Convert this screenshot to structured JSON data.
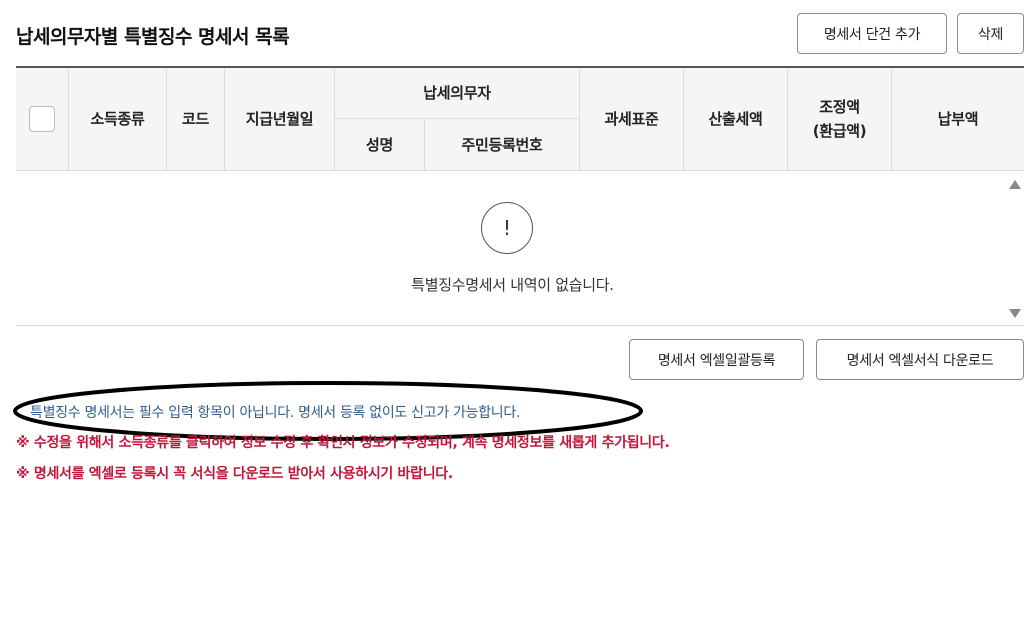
{
  "page": {
    "title": "납세의무자별 특별징수 명세서 목록",
    "add_button": "명세서 단건 추가",
    "delete_button": "삭제"
  },
  "table": {
    "headers": {
      "income_type": "소득종류",
      "code": "코드",
      "pay_date": "지급년월일",
      "taxpayer_group": "납세의무자",
      "name": "성명",
      "resident_number": "주민등록번호",
      "tax_base": "과세표준",
      "calculated_tax": "산출세액",
      "adjustment_line1": "조정액",
      "adjustment_line2": "(환급액)",
      "payment_amount": "납부액"
    },
    "empty_icon": "!",
    "empty_message": "특별징수명세서 내역이 없습니다."
  },
  "actions": {
    "excel_upload": "명세서 엑셀일괄등록",
    "excel_template_download": "명세서 엑셀서식 다운로드"
  },
  "notices": {
    "info": "특별징수 명세서는 필수 입력 항목이 아닙니다. 명세서 등록 없이도 신고가 가능합니다.",
    "warning_1": "※ 수정을 위해서 소득종류를 클릭하여 정보 수정 후 확인시 정보가 수정되며, 계속 명세정보를 새롭게 추가됩니다.",
    "warning_2": "※ 명세서를 엑셀로 등록시 꼭 서식을 다운로드 받아서 사용하시기 바랍니다."
  },
  "colors": {
    "info_text": "#2f5d8c",
    "warning_text": "#c0163a",
    "header_bg": "#f5f5f5"
  }
}
